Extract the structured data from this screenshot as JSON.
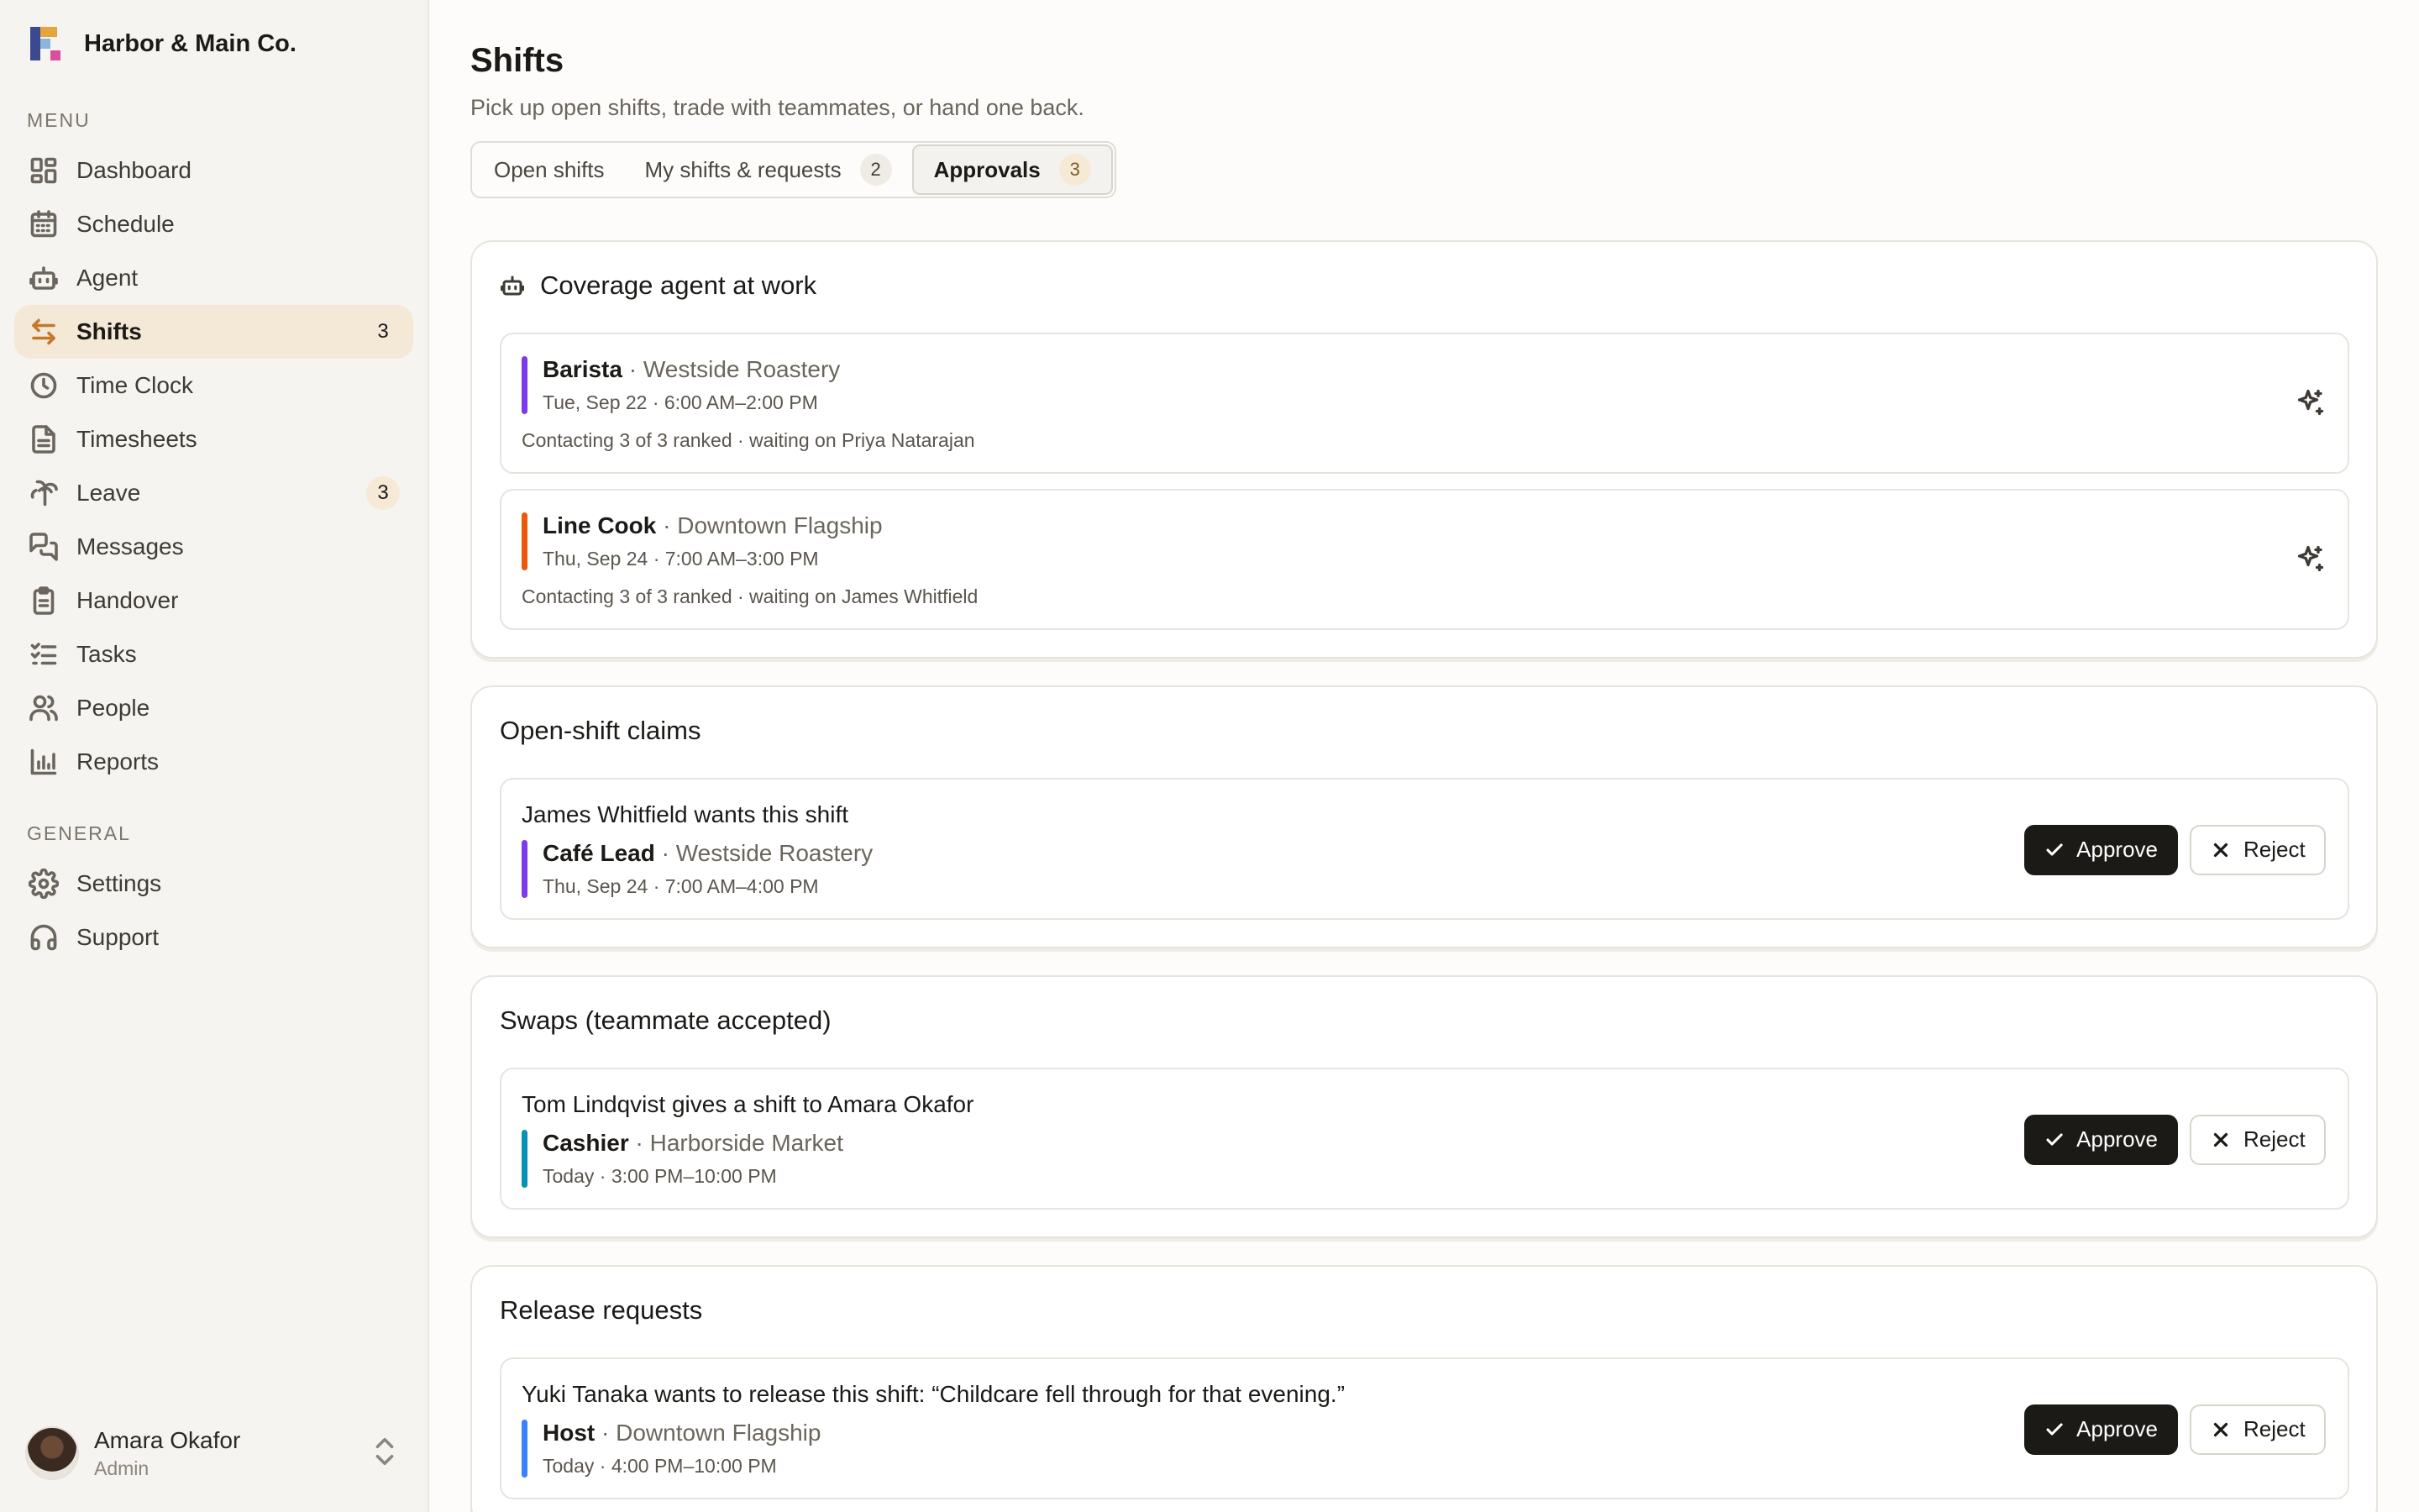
{
  "app": {
    "brand": "Harbor & Main Co."
  },
  "sidebar": {
    "menu_label": "MENU",
    "general_label": "GENERAL",
    "menu_items": [
      {
        "label": "Dashboard",
        "icon": "dashboard-icon",
        "badge": ""
      },
      {
        "label": "Schedule",
        "icon": "calendar-icon",
        "badge": ""
      },
      {
        "label": "Agent",
        "icon": "bot-icon",
        "badge": ""
      },
      {
        "label": "Shifts",
        "icon": "swap-arrows-icon",
        "badge": "3",
        "active": true
      },
      {
        "label": "Time Clock",
        "icon": "clock-icon",
        "badge": ""
      },
      {
        "label": "Timesheets",
        "icon": "document-icon",
        "badge": ""
      },
      {
        "label": "Leave",
        "icon": "palm-tree-icon",
        "badge": "3"
      },
      {
        "label": "Messages",
        "icon": "chat-icon",
        "badge": ""
      },
      {
        "label": "Handover",
        "icon": "clipboard-icon",
        "badge": ""
      },
      {
        "label": "Tasks",
        "icon": "checklist-icon",
        "badge": ""
      },
      {
        "label": "People",
        "icon": "people-icon",
        "badge": ""
      },
      {
        "label": "Reports",
        "icon": "bar-chart-icon",
        "badge": ""
      }
    ],
    "general_items": [
      {
        "label": "Settings",
        "icon": "gear-icon"
      },
      {
        "label": "Support",
        "icon": "headset-icon"
      }
    ],
    "user": {
      "name": "Amara Okafor",
      "role": "Admin"
    }
  },
  "page": {
    "title": "Shifts",
    "subtitle": "Pick up open shifts, trade with teammates, or hand one back.",
    "tabs": [
      {
        "label": "Open shifts",
        "count": ""
      },
      {
        "label": "My shifts & requests",
        "count": "2"
      },
      {
        "label": "Approvals",
        "count": "3",
        "active": true
      }
    ]
  },
  "coverage": {
    "title": "Coverage agent at work",
    "items": [
      {
        "role": "Barista",
        "location": " · Westside Roastery",
        "time": "Tue, Sep 22 · 6:00 AM–2:00 PM",
        "status": "Contacting 3 of 3 ranked · waiting on Priya Natarajan",
        "accent": "#7c3aed"
      },
      {
        "role": "Line Cook",
        "location": " · Downtown Flagship",
        "time": "Thu, Sep 24 · 7:00 AM–3:00 PM",
        "status": "Contacting 3 of 3 ranked · waiting on James Whitfield",
        "accent": "#ea580c"
      }
    ]
  },
  "claims": {
    "title": "Open-shift claims",
    "items": [
      {
        "headline": "James Whitfield wants this shift",
        "role": "Café Lead",
        "location": " · Westside Roastery",
        "time": "Thu, Sep 24 · 7:00 AM–4:00 PM",
        "accent": "#7c3aed"
      }
    ]
  },
  "swaps": {
    "title": "Swaps (teammate accepted)",
    "items": [
      {
        "headline": "Tom Lindqvist gives a shift to Amara Okafor",
        "role": "Cashier",
        "location": " · Harborside Market",
        "time": "Today · 3:00 PM–10:00 PM",
        "accent": "#0891b2"
      }
    ]
  },
  "releases": {
    "title": "Release requests",
    "items": [
      {
        "headline": "Yuki Tanaka wants to release this shift: “Childcare fell through for that evening.”",
        "role": "Host",
        "location": " · Downtown Flagship",
        "time": "Today · 4:00 PM–10:00 PM",
        "accent": "#3b82f6"
      }
    ]
  },
  "actions": {
    "approve": "Approve",
    "reject": "Reject"
  },
  "colors": {
    "active_nav_bg": "#f4e8d6",
    "active_icon": "#c4782b",
    "primary_button": "#1c1a17"
  }
}
